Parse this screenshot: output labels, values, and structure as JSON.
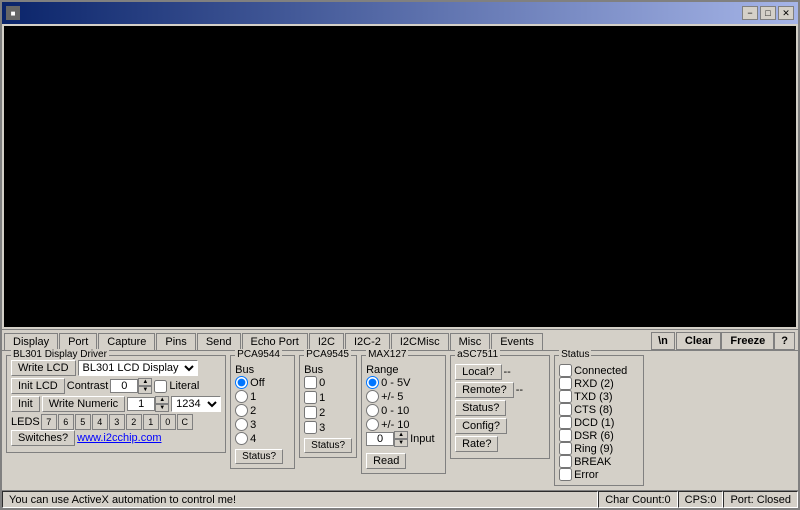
{
  "window": {
    "title": "",
    "controls": {
      "minimize": "−",
      "maximize": "□",
      "close": "✕"
    }
  },
  "tabs": [
    {
      "label": "Display",
      "active": true
    },
    {
      "label": "Port"
    },
    {
      "label": "Capture"
    },
    {
      "label": "Pins"
    },
    {
      "label": "Send"
    },
    {
      "label": "Echo Port"
    },
    {
      "label": "I2C"
    },
    {
      "label": "I2C-2"
    },
    {
      "label": "I2CMisc"
    },
    {
      "label": "Misc"
    },
    {
      "label": "Events"
    }
  ],
  "toolbar_right": {
    "backslash_n": "\\n",
    "clear": "Clear",
    "freeze": "Freeze",
    "help": "?"
  },
  "bl301": {
    "group_label": "BL301 Display Driver",
    "write_lcd_label": "Write LCD",
    "lcd_select_value": "BL301 LCD Display",
    "init_lcd_label": "Init LCD",
    "contrast_label": "Contrast",
    "contrast_value": "0",
    "literal_label": "Literal",
    "init_label": "Init",
    "write_numeric_label": "Write Numeric",
    "numeric_value": "1",
    "numeric_select": "1234",
    "leds_label": "LEDS",
    "leds": [
      "7",
      "6",
      "5",
      "4",
      "3",
      "2",
      "1",
      "0",
      "C"
    ],
    "switches_label": "Switches?",
    "website": "www.i2cchip.com"
  },
  "pca9544": {
    "group_label": "PCA9544",
    "bus_label": "Bus",
    "options": [
      "Off",
      "1",
      "2",
      "3",
      "4"
    ],
    "selected": "Off",
    "status_label": "Status?"
  },
  "pca9545": {
    "group_label": "PCA9545",
    "bus_label": "Bus",
    "checkboxes": [
      "0",
      "1",
      "2",
      "3"
    ],
    "status_label": "Status?"
  },
  "max127": {
    "group_label": "MAX127",
    "range_label": "Range",
    "ranges": [
      "0 - 5V",
      "+/- 5",
      "0 - 10",
      "+/- 10"
    ],
    "selected": "0 - 5V",
    "input_label": "Input",
    "input_value": "0",
    "read_label": "Read"
  },
  "asc7511": {
    "group_label": "aSC7511",
    "local_label": "Local?",
    "remote_label": "Remote?",
    "status_label": "Status?",
    "config_label": "Config?",
    "rate_label": "Rate?",
    "local_value": "--",
    "remote_value": "--"
  },
  "status_panel": {
    "group_label": "Status",
    "connected_label": "Connected",
    "rxd_label": "RXD (2)",
    "txd_label": "TXD (3)",
    "cts_label": "CTS (8)",
    "dcd_label": "DCD (1)",
    "dsr_label": "DSR (6)",
    "ring_label": "Ring (9)",
    "break_label": "BREAK",
    "error_label": "Error"
  },
  "status_bar": {
    "message": "You can use ActiveX automation to control me!",
    "char_count_label": "Char Count:",
    "char_count_value": "0",
    "cps_label": "CPS:",
    "cps_value": "0",
    "port_label": "Port: Closed"
  }
}
